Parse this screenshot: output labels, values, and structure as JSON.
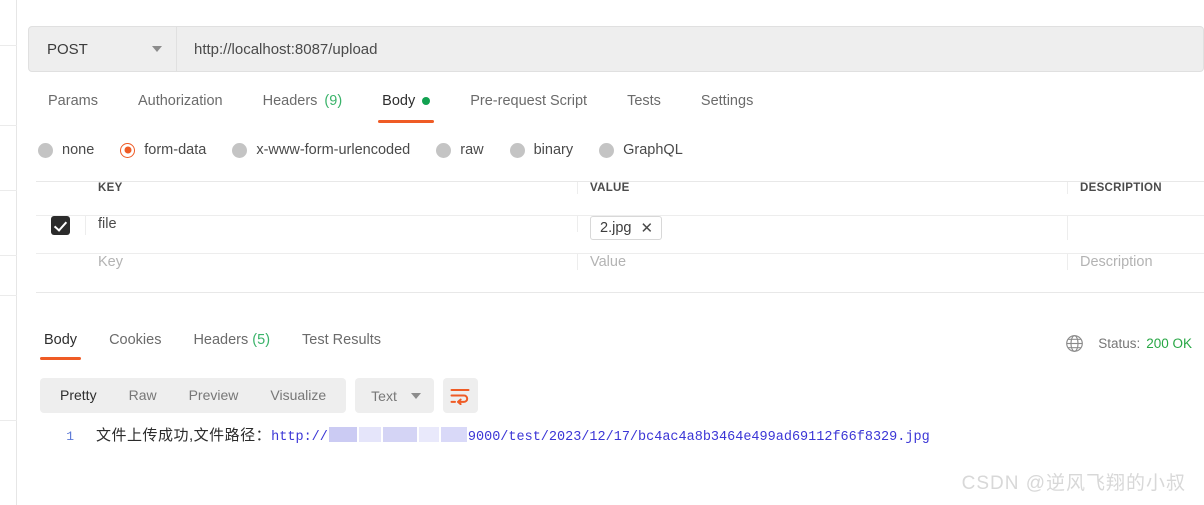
{
  "request": {
    "method": "POST",
    "url": "http://localhost:8087/upload",
    "tabs": [
      {
        "label": "Params",
        "count": "",
        "active": false,
        "dot": false
      },
      {
        "label": "Authorization",
        "count": "",
        "active": false,
        "dot": false
      },
      {
        "label": "Headers",
        "count": "(9)",
        "active": false,
        "dot": false
      },
      {
        "label": "Body",
        "count": "",
        "active": true,
        "dot": true
      },
      {
        "label": "Pre-request Script",
        "count": "",
        "active": false,
        "dot": false
      },
      {
        "label": "Tests",
        "count": "",
        "active": false,
        "dot": false
      },
      {
        "label": "Settings",
        "count": "",
        "active": false,
        "dot": false
      }
    ],
    "body_types": [
      {
        "label": "none",
        "selected": false
      },
      {
        "label": "form-data",
        "selected": true
      },
      {
        "label": "x-www-form-urlencoded",
        "selected": false
      },
      {
        "label": "raw",
        "selected": false
      },
      {
        "label": "binary",
        "selected": false
      },
      {
        "label": "GraphQL",
        "selected": false
      }
    ],
    "table": {
      "headers": {
        "key": "KEY",
        "value": "VALUE",
        "description": "DESCRIPTION"
      },
      "rows": [
        {
          "checked": true,
          "key": "file",
          "value_chip": "2.jpg",
          "chip_remove": "✕",
          "description": ""
        }
      ],
      "placeholders": {
        "key": "Key",
        "value": "Value",
        "description": "Description"
      }
    }
  },
  "response": {
    "tabs": [
      {
        "label": "Body",
        "count": "",
        "active": true
      },
      {
        "label": "Cookies",
        "count": "",
        "active": false
      },
      {
        "label": "Headers",
        "count": "(5)",
        "active": false
      },
      {
        "label": "Test Results",
        "count": "",
        "active": false
      }
    ],
    "status_label": "Status:",
    "status_value": "200 OK",
    "view_modes": [
      {
        "label": "Pretty",
        "active": true
      },
      {
        "label": "Raw",
        "active": false
      },
      {
        "label": "Preview",
        "active": false
      },
      {
        "label": "Visualize",
        "active": false
      }
    ],
    "format": "Text",
    "body": {
      "line_number": "1",
      "message": "文件上传成功,文件路径：",
      "url_prefix": "http://",
      "url_suffix": "9000/test/2023/12/17/bc4ac4a8b3464e499ad69112f66f8329.jpg"
    }
  },
  "watermark": "CSDN @逆风飞翔的小叔",
  "colors": {
    "accent": "#ef5b25",
    "success": "#28a745",
    "link": "#3b36d6"
  }
}
